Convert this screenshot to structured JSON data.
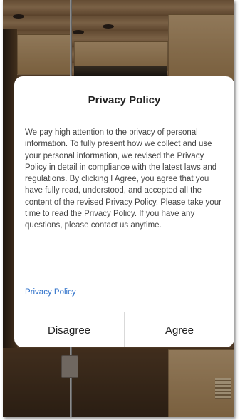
{
  "dialog": {
    "title": "Privacy Policy",
    "body": "We pay high attention to the privacy of personal information. To fully present how we collect and use your personal information, we revised the Privacy Policy in detail in compliance with the latest laws and regulations. By clicking I Agree, you agree that you have fully read, understood, and accepted all the content of the revised Privacy Policy. Please take your time to read the Privacy Policy. If you have any questions, please contact us anytime.",
    "link_label": "Privacy Policy",
    "disagree_label": "Disagree",
    "agree_label": "Agree"
  },
  "colors": {
    "link": "#2c6fc9",
    "dialog_background": "#ffffff",
    "divider": "#d9d9d9"
  }
}
